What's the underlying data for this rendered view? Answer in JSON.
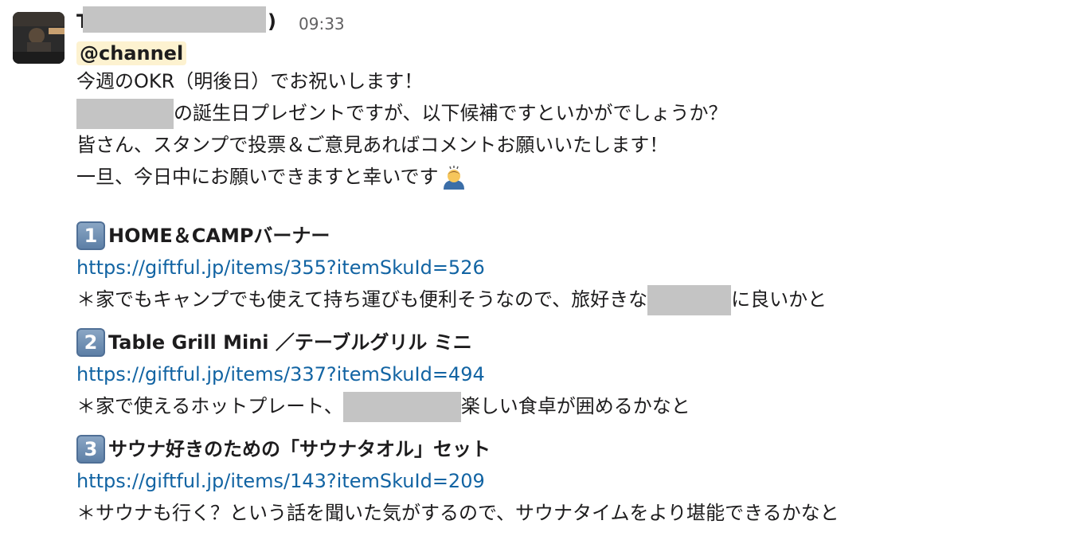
{
  "message": {
    "sender_visible_prefix": "T",
    "sender_suffix": ")",
    "time": "09:33",
    "mention": "@channel",
    "intro_lines": [
      "今週のOKR（明後日）でお祝いします！",
      "の誕生日プレゼントですが、以下候補ですといかがでしょうか？",
      "皆さん、スタンプで投票＆ご意見あればコメントお願いいたします！",
      "一旦、今日中にお願いできますと幸いです"
    ],
    "emoji": "bowing-person-emoji"
  },
  "items": [
    {
      "number": "1",
      "title": "HOME＆CAMPバーナー",
      "url": "https://giftful.jp/items/355?itemSkuId=526",
      "desc_before": "＊家でもキャンプでも使えて持ち運びも便利そうなので、旅好きな",
      "desc_after": "に良いかと"
    },
    {
      "number": "2",
      "title": "Table Grill Mini ／テーブルグリル ミニ",
      "url": "https://giftful.jp/items/337?itemSkuId=494",
      "desc_before": "＊家で使えるホットプレート、",
      "desc_after": "楽しい食卓が囲めるかなと"
    },
    {
      "number": "3",
      "title": "サウナ好きのための「サウナタオル」セット",
      "url": "https://giftful.jp/items/143?itemSkuId=209",
      "desc_before": "＊サウナも行く？という話を聞いた気がするので、サウナタイムをより堪能できるかなと",
      "desc_after": ""
    }
  ]
}
